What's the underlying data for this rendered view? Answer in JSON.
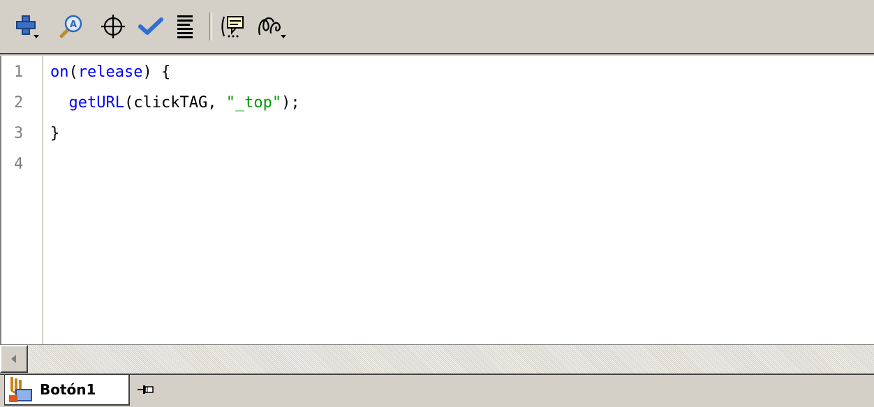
{
  "toolbar": {
    "buttons": [
      {
        "name": "add-statement",
        "icon": "plus-dropdown-icon"
      },
      {
        "name": "find",
        "icon": "magnifier-icon"
      },
      {
        "name": "insert-target-path",
        "icon": "crosshair-icon"
      },
      {
        "name": "check-syntax",
        "icon": "checkmark-icon"
      },
      {
        "name": "auto-format",
        "icon": "auto-format-lines-icon"
      },
      {
        "name": "show-code-hint",
        "icon": "code-hint-icon"
      },
      {
        "name": "debug-options",
        "icon": "debug-options-dropdown-icon"
      }
    ]
  },
  "editor": {
    "line_numbers": [
      "1",
      "2",
      "3",
      "4"
    ],
    "lines": [
      {
        "indent": "",
        "parts": [
          {
            "cls": "kw",
            "text": "on"
          },
          {
            "cls": "plain",
            "text": "("
          },
          {
            "cls": "kw",
            "text": "release"
          },
          {
            "cls": "plain",
            "text": ") {"
          }
        ]
      },
      {
        "indent": "  ",
        "parts": [
          {
            "cls": "fn",
            "text": "getURL"
          },
          {
            "cls": "plain",
            "text": "(clickTAG, "
          },
          {
            "cls": "str",
            "text": "\"_top\""
          },
          {
            "cls": "plain",
            "text": ");"
          }
        ]
      },
      {
        "indent": "",
        "parts": [
          {
            "cls": "plain",
            "text": "}"
          }
        ]
      },
      {
        "indent": "",
        "parts": []
      }
    ]
  },
  "tabs": {
    "active_label": "Botón1",
    "active_icon": "button-symbol-icon",
    "pin_icon": "pin-icon"
  },
  "colors": {
    "keyword": "#0000ff",
    "string": "#009900",
    "line_number": "#808080",
    "chrome": "#d4d0c8"
  }
}
